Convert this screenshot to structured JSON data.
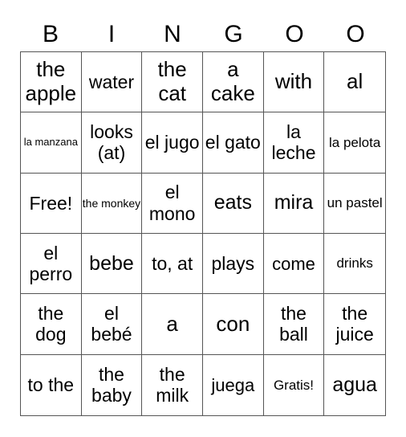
{
  "header": {
    "letters": [
      "B",
      "I",
      "N",
      "G",
      "O",
      "O"
    ]
  },
  "board": {
    "rows": [
      [
        "the apple",
        "water",
        "the cat",
        "a cake",
        "with",
        "al"
      ],
      [
        "la manzana",
        "looks (at)",
        "el jugo",
        "el gato",
        "la leche",
        "la pelota"
      ],
      [
        "Free!",
        "the monkey",
        "el mono",
        "eats",
        "mira",
        "un pastel"
      ],
      [
        "el perro",
        "bebe",
        "to, at",
        "plays",
        "come",
        "drinks"
      ],
      [
        "the dog",
        "el bebé",
        "a",
        "con",
        "the ball",
        "the juice"
      ],
      [
        "to the",
        "the baby",
        "the milk",
        "juega",
        "Gratis!",
        "agua"
      ]
    ]
  }
}
